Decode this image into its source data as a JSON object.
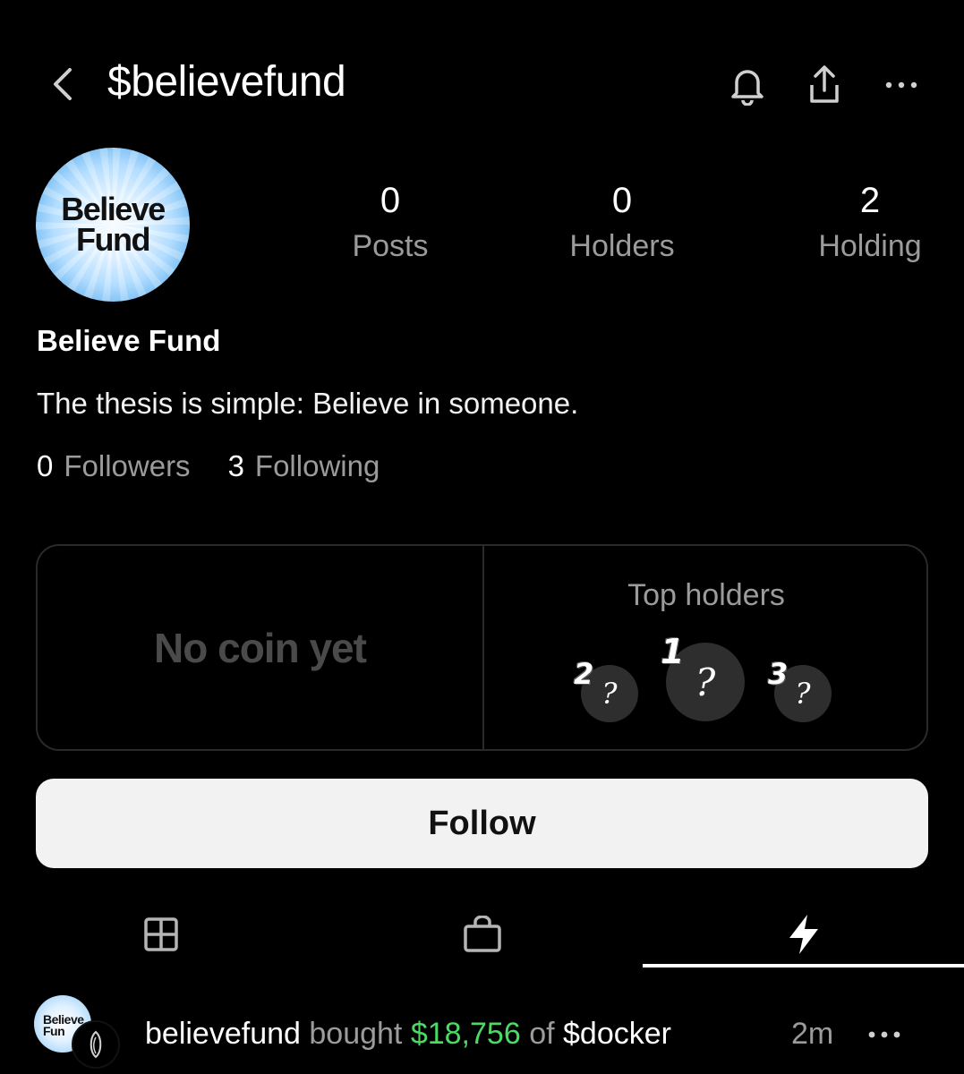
{
  "header": {
    "handle": "$believefund",
    "icons": [
      "back-icon",
      "bell-icon",
      "share-icon",
      "more-icon"
    ]
  },
  "profile": {
    "avatar_text_line1": "Believe",
    "avatar_text_line2": "Fund",
    "name": "Believe Fund",
    "bio": "The thesis is simple: Believe in someone.",
    "stats": [
      {
        "value": "0",
        "label": "Posts"
      },
      {
        "value": "0",
        "label": "Holders"
      },
      {
        "value": "2",
        "label": "Holding"
      }
    ],
    "followers_count": "0",
    "followers_label": "Followers",
    "following_count": "3",
    "following_label": "Following"
  },
  "coin_card": {
    "no_coin": "No coin yet",
    "top_holders_title": "Top holders",
    "holders": [
      {
        "rank": "1",
        "glyph": "?"
      },
      {
        "rank": "2",
        "glyph": "?"
      },
      {
        "rank": "3",
        "glyph": "?"
      }
    ]
  },
  "follow_button": "Follow",
  "tabs": [
    {
      "icon": "grid-icon",
      "active": false
    },
    {
      "icon": "bag-icon",
      "active": false
    },
    {
      "icon": "lightning-icon",
      "active": true
    }
  ],
  "activity": {
    "avatar_text_line1": "Believe",
    "avatar_text_line2": "Fun",
    "user": "believefund",
    "verb": "bought",
    "amount": "$18,756",
    "of": "of",
    "token": "$docker",
    "time": "2m"
  },
  "colors": {
    "background": "#000000",
    "muted": "#9b9b9b",
    "positive": "#4cd964",
    "button": "#f2f2f2"
  }
}
